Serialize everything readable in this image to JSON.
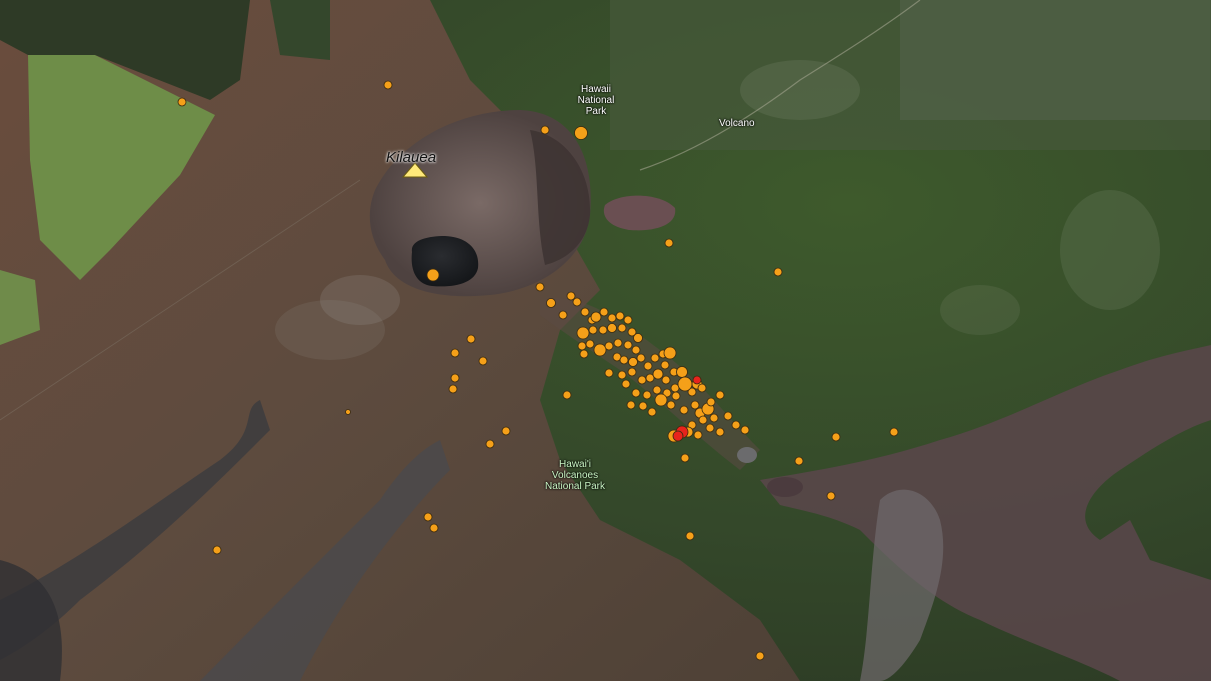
{
  "map": {
    "labels": {
      "summit": "Kilauea",
      "town_volcano": "Volcano",
      "town_hnp": [
        "Hawaii",
        "National",
        "Park"
      ],
      "park": [
        "Hawai'i",
        "Volcanoes",
        "National Park"
      ]
    },
    "colors": {
      "quake_default": "#f5a019",
      "quake_recent": "#e8231c",
      "quake_stroke": "#3a2a10",
      "summit_marker": "#ffe97a"
    },
    "icons": {
      "summit_marker": "triangle-volcano-icon",
      "quake_marker": "circle-earthquake-icon"
    },
    "earthquake_count_shown": 163
  }
}
